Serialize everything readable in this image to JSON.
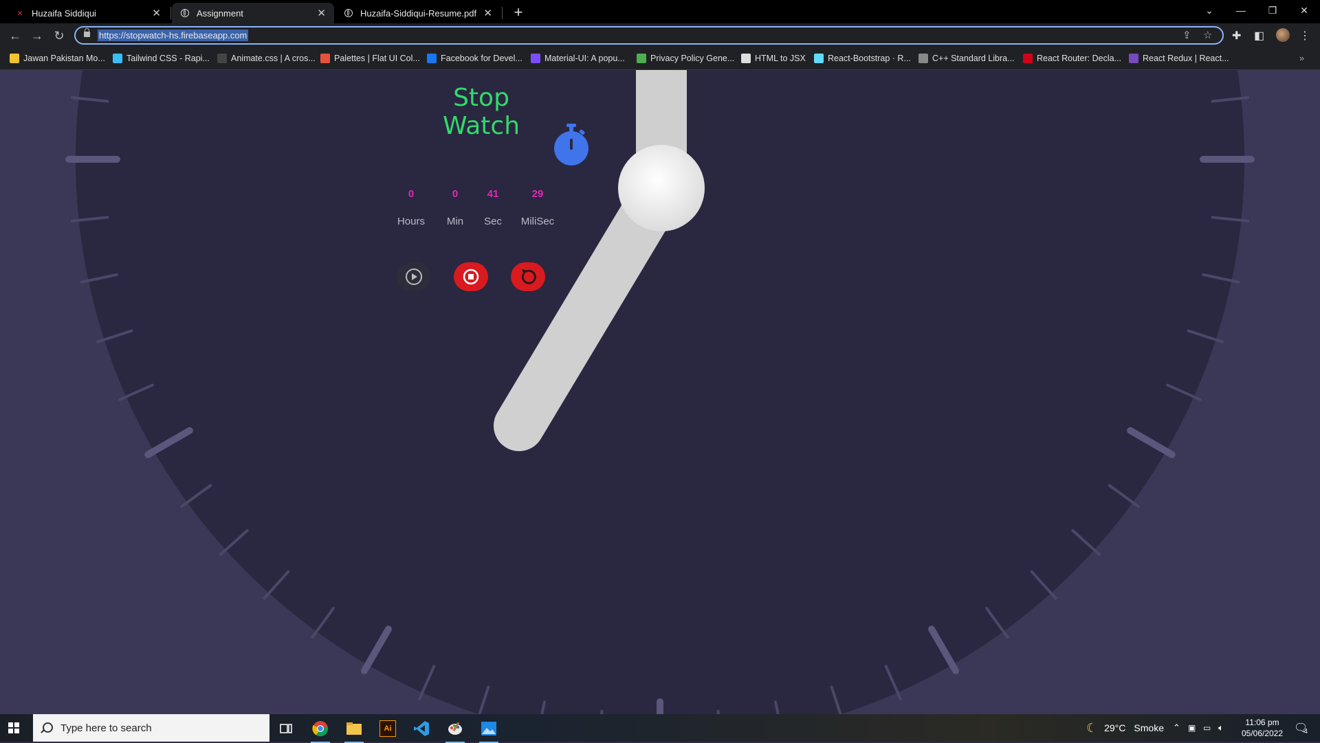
{
  "browser": {
    "tabs": [
      {
        "title": "Huzaifa Siddiqui",
        "active": false
      },
      {
        "title": "Assignment",
        "active": true
      },
      {
        "title": "Huzaifa-Siddiqui-Resume.pdf",
        "active": false
      }
    ],
    "url": "https://stopwatch-hs.firebaseapp.com",
    "bookmarks": [
      {
        "label": "Jawan Pakistan Mo...",
        "color": "#f2c230"
      },
      {
        "label": "Tailwind CSS - Rapi...",
        "color": "#38bdf8"
      },
      {
        "label": "Animate.css | A cros...",
        "color": "#444444"
      },
      {
        "label": "Palettes | Flat UI Col...",
        "color": "#e5533d"
      },
      {
        "label": "Facebook for Devel...",
        "color": "#1877f2"
      },
      {
        "label": "Material-UI: A popu...",
        "color": "#7c4dff"
      },
      {
        "label": "Privacy Policy Gene...",
        "color": "#4caf50"
      },
      {
        "label": "HTML to JSX",
        "color": "#dddddd"
      },
      {
        "label": "React-Bootstrap · R...",
        "color": "#61dafb"
      },
      {
        "label": "C++ Standard Libra...",
        "color": "#888888"
      },
      {
        "label": "React Router: Decla...",
        "color": "#d0021b"
      },
      {
        "label": "React Redux | React...",
        "color": "#764abc"
      }
    ]
  },
  "app": {
    "title": "Stop Watch",
    "accent": "#32d96c",
    "value_color": "#e327b5",
    "time": {
      "hours": "0",
      "minutes": "0",
      "seconds": "41",
      "milliseconds": "29"
    },
    "labels": {
      "hours": "Hours",
      "minutes": "Min",
      "seconds": "Sec",
      "milliseconds": "MiliSec"
    },
    "controls": [
      "play",
      "stop",
      "reset"
    ]
  },
  "taskbar": {
    "search_placeholder": "Type here to search",
    "weather": "29°C",
    "weather_condition": "Smoke",
    "time": "11:06 pm",
    "date": "05/06/2022",
    "notifications": "4"
  }
}
